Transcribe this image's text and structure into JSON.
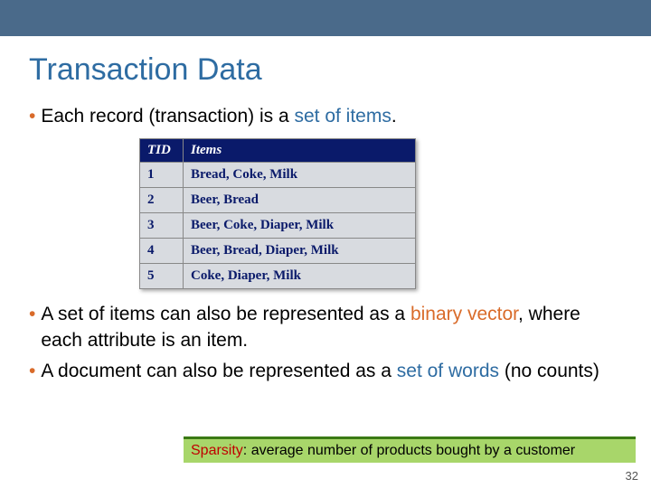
{
  "title": "Transaction Data",
  "bullets": {
    "b1_pre": "Each record (transaction) is a ",
    "b1_hl": "set of items",
    "b1_post": ".",
    "b2_pre": "A set of items can also be represented as a ",
    "b2_hl": "binary vector",
    "b2_post": ", where each attribute is an item.",
    "b3_pre": "A document can also be represented as a ",
    "b3_hl": "set of words",
    "b3_post": " (no counts)"
  },
  "table": {
    "headers": {
      "tid": "TID",
      "items": "Items"
    },
    "rows": [
      {
        "tid": "1",
        "items": "Bread, Coke, Milk"
      },
      {
        "tid": "2",
        "items": "Beer, Bread"
      },
      {
        "tid": "3",
        "items": "Beer, Coke, Diaper, Milk"
      },
      {
        "tid": "4",
        "items": "Beer, Bread, Diaper, Milk"
      },
      {
        "tid": "5",
        "items": "Coke, Diaper, Milk"
      }
    ]
  },
  "footnote": {
    "sparsity": "Sparsity",
    "rest": ": average number of products bought by a customer"
  },
  "page_number": "32"
}
